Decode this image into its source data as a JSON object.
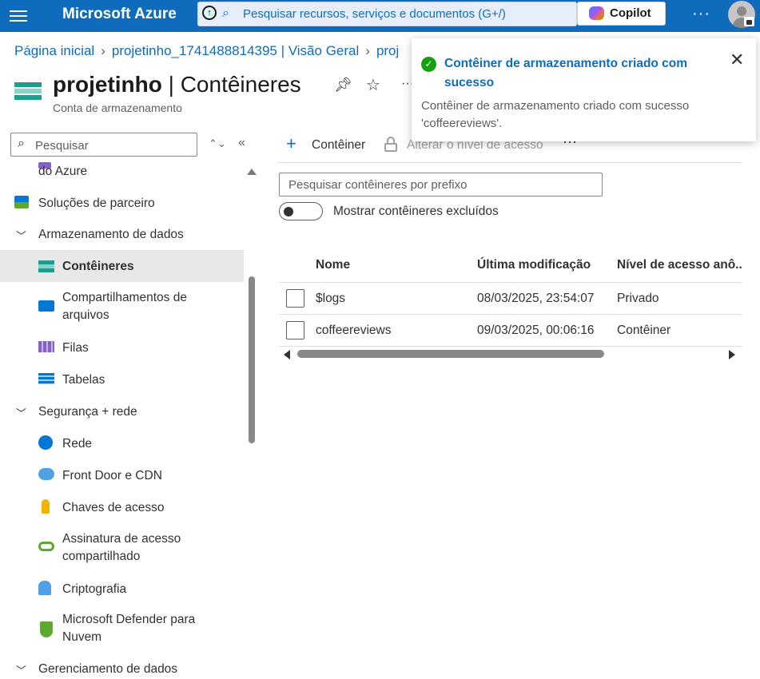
{
  "topbar": {
    "brand": "Microsoft Azure",
    "search_placeholder": "Pesquisar recursos, serviços e documentos (G+/)",
    "copilot_label": "Copilot",
    "more": "···"
  },
  "breadcrumb": {
    "items": [
      "Página inicial",
      "projetinho_1741488814395 | Visão Geral",
      "proj"
    ]
  },
  "page": {
    "title_bold": "projetinho",
    "title_rest": " | Contêineres",
    "subtitle": "Conta de armazenamento",
    "more": "···"
  },
  "sidebar": {
    "search_placeholder": "Pesquisar",
    "items": [
      {
        "label": "do Azure",
        "icon": "azure-icon"
      },
      {
        "label": "Soluções de parceiro",
        "icon": "partner-icon"
      },
      {
        "label": "Armazenamento de dados",
        "group": true
      },
      {
        "label": "Contêineres",
        "icon": "containers-icon",
        "selected": true
      },
      {
        "label": "Compartilhamentos de arquivos",
        "icon": "file-shares-icon"
      },
      {
        "label": "Filas",
        "icon": "queues-icon"
      },
      {
        "label": "Tabelas",
        "icon": "tables-icon"
      },
      {
        "label": "Segurança + rede",
        "group": true
      },
      {
        "label": "Rede",
        "icon": "network-icon"
      },
      {
        "label": "Front Door e CDN",
        "icon": "cdn-icon"
      },
      {
        "label": "Chaves de acesso",
        "icon": "key-icon"
      },
      {
        "label": "Assinatura de acesso compartilhado",
        "icon": "sas-icon"
      },
      {
        "label": "Criptografia",
        "icon": "encryption-icon"
      },
      {
        "label": "Microsoft Defender para Nuvem",
        "icon": "defender-icon"
      },
      {
        "label": "Gerenciamento de dados",
        "group": true
      }
    ]
  },
  "toolbar": {
    "add_label": "Contêiner",
    "access_label": "Alterar o nível de acesso",
    "more": "···"
  },
  "filters": {
    "prefix_placeholder": "Pesquisar contêineres por prefixo",
    "show_deleted_label": "Mostrar contêineres excluídos",
    "show_deleted": false
  },
  "table": {
    "headers": [
      "Nome",
      "Última modificação",
      "Nível de acesso anô.."
    ],
    "rows": [
      {
        "name": "$logs",
        "modified": "08/03/2025, 23:54:07",
        "access": "Privado"
      },
      {
        "name": "coffeereviews",
        "modified": "09/03/2025, 00:06:16",
        "access": "Contêiner"
      }
    ]
  },
  "toast": {
    "title": "Contêiner de armazenamento criado com sucesso",
    "message": "Contêiner de armazenamento criado com sucesso 'coffeereviews'.",
    "status_color": "#13a10e"
  },
  "colors": {
    "accent": "#0f6cbd",
    "topbar": "#0f6cbd"
  }
}
